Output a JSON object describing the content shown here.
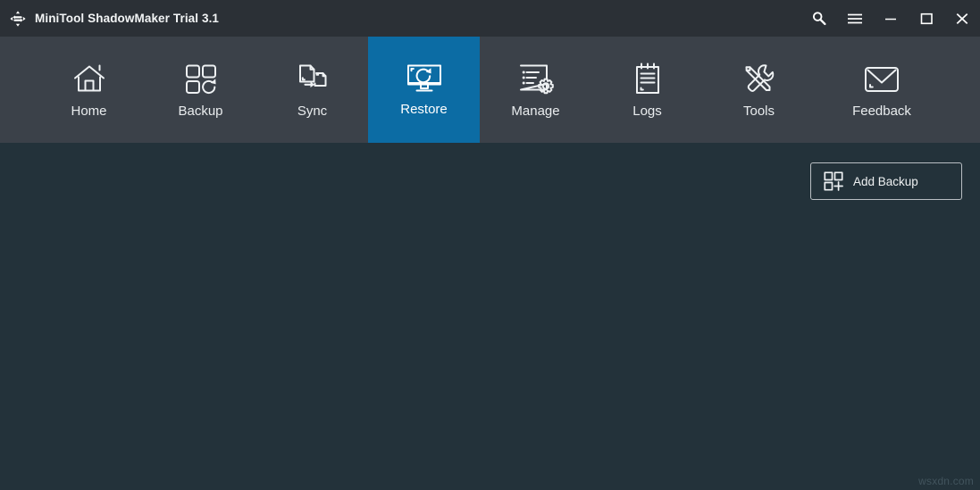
{
  "window": {
    "title": "MiniTool ShadowMaker Trial 3.1",
    "logo_icon": "four-way-arrows-icon",
    "controls": [
      {
        "name": "search-icon",
        "label": "Search"
      },
      {
        "name": "menu-icon",
        "label": "Menu"
      },
      {
        "name": "minimize-icon",
        "label": "Minimize"
      },
      {
        "name": "maximize-icon",
        "label": "Maximize"
      },
      {
        "name": "close-icon",
        "label": "Close"
      }
    ]
  },
  "nav": {
    "active_index": 3,
    "items": [
      {
        "label": "Home",
        "icon": "house-icon"
      },
      {
        "label": "Backup",
        "icon": "squares-refresh-icon"
      },
      {
        "label": "Sync",
        "icon": "two-documents-arrow-icon"
      },
      {
        "label": "Restore",
        "icon": "monitor-refresh-icon"
      },
      {
        "label": "Manage",
        "icon": "list-gear-icon"
      },
      {
        "label": "Logs",
        "icon": "notepad-icon"
      },
      {
        "label": "Tools",
        "icon": "wrench-screwdriver-icon"
      },
      {
        "label": "Feedback",
        "icon": "envelope-icon"
      }
    ]
  },
  "content": {
    "add_backup": {
      "label": "Add Backup",
      "icon": "squares-plus-icon"
    },
    "watermark": "wsxdn.com"
  },
  "colors": {
    "titlebar_bg": "#2b3036",
    "navbar_bg": "#3b4149",
    "content_bg": "#23323a",
    "accent_blue": "#0c6ca4",
    "icon_stroke": "#eef1f3",
    "button_border": "#b9bfc3"
  }
}
